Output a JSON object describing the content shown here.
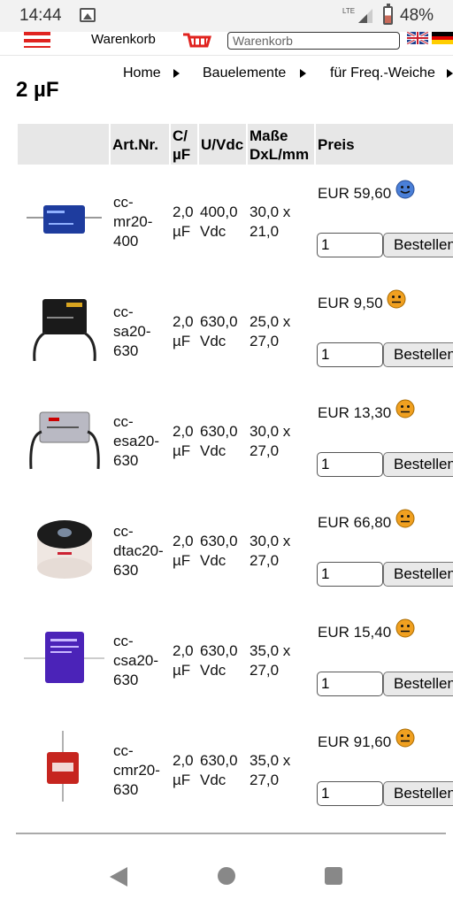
{
  "status_bar": {
    "time": "14:44",
    "network": "LTE",
    "battery_percent": "48%",
    "icons": [
      "gallery-icon",
      "signal-icon",
      "battery-icon"
    ]
  },
  "header": {
    "cart_label": "Warenkorb",
    "search_placeholder": "Warenkorb",
    "icons": [
      "menu-icon",
      "cart-icon",
      "flag-uk-icon",
      "flag-de-icon"
    ],
    "colors": {
      "menu": "#e0231f",
      "cart": "#e0231f"
    }
  },
  "breadcrumb": [
    "Home",
    "Bauelemente",
    "für Freq.-Weiche"
  ],
  "page_title": "2 µF",
  "table": {
    "headers": {
      "artnr": "Art.Nr.",
      "cap": [
        "C/",
        "µF"
      ],
      "voltage": "U/Vdc",
      "size": [
        "Maße",
        "DxL/mm"
      ],
      "price": "Preis"
    },
    "rows": [
      {
        "artnr": [
          "cc-",
          "mr20-",
          "400"
        ],
        "cap": [
          "2,0",
          "µF"
        ],
        "voltage": [
          "400,0",
          "Vdc"
        ],
        "size": [
          "30,0 x",
          "21,0"
        ],
        "price": "EUR 59,60",
        "availability": "smiley-blue-icon",
        "qty": "1",
        "order_label": "Bestellen"
      },
      {
        "artnr": [
          "cc-",
          "sa20-",
          "630"
        ],
        "cap": [
          "2,0",
          "µF"
        ],
        "voltage": [
          "630,0",
          "Vdc"
        ],
        "size": [
          "25,0 x",
          "27,0"
        ],
        "price": "EUR 9,50",
        "availability": "smiley-orange-icon",
        "qty": "1",
        "order_label": "Bestellen"
      },
      {
        "artnr": [
          "cc-",
          "esa20-",
          "630"
        ],
        "cap": [
          "2,0",
          "µF"
        ],
        "voltage": [
          "630,0",
          "Vdc"
        ],
        "size": [
          "30,0 x",
          "27,0"
        ],
        "price": "EUR 13,30",
        "availability": "smiley-orange-icon",
        "qty": "1",
        "order_label": "Bestellen"
      },
      {
        "artnr": [
          "cc-",
          "dtac20-",
          "630"
        ],
        "cap": [
          "2,0",
          "µF"
        ],
        "voltage": [
          "630,0",
          "Vdc"
        ],
        "size": [
          "30,0 x",
          "27,0"
        ],
        "price": "EUR 66,80",
        "availability": "smiley-orange-icon",
        "qty": "1",
        "order_label": "Bestellen"
      },
      {
        "artnr": [
          "cc-",
          "csa20-",
          "630"
        ],
        "cap": [
          "2,0",
          "µF"
        ],
        "voltage": [
          "630,0",
          "Vdc"
        ],
        "size": [
          "35,0 x",
          "27,0"
        ],
        "price": "EUR 15,40",
        "availability": "smiley-orange-icon",
        "qty": "1",
        "order_label": "Bestellen"
      },
      {
        "artnr": [
          "cc-",
          "cmr20-",
          "630"
        ],
        "cap": [
          "2,0",
          "µF"
        ],
        "voltage": [
          "630,0",
          "Vdc"
        ],
        "size": [
          "35,0 x",
          "27,0"
        ],
        "price": "EUR 91,60",
        "availability": "smiley-orange-icon",
        "qty": "1",
        "order_label": "Bestellen"
      }
    ],
    "colors": {
      "smiley_blue": "#4a7fd8",
      "smiley_orange": "#f0a020",
      "header_bg": "#e7e7e7"
    }
  },
  "nav_bar": {
    "icons": [
      "back-icon",
      "home-icon",
      "recents-icon"
    ]
  }
}
